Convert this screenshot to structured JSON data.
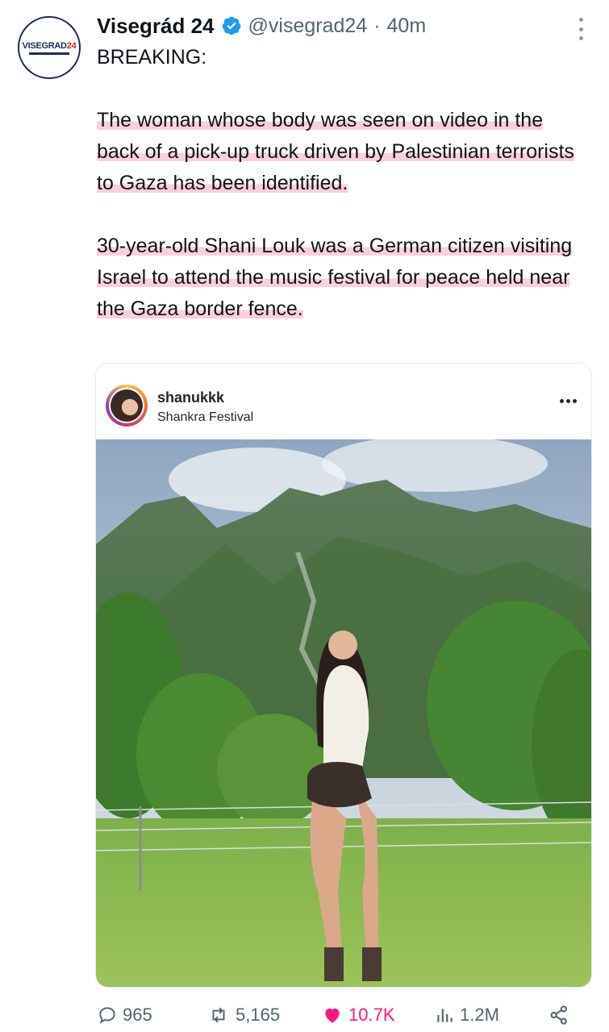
{
  "account": {
    "avatar_text": "VISEGRAD24",
    "name": "Visegrád 24",
    "handle": "@visegrad24",
    "separator": "·",
    "time": "40m",
    "verified_icon": "verified-badge-icon"
  },
  "tweet": {
    "line1": "BREAKING:",
    "paragraph1": "The woman whose body was seen on video in the back of a pick-up truck driven by Palestinian terrorists to Gaza has been identified.",
    "paragraph2": "30-year-old Shani Louk was a German citizen visiting Israel to attend the music festival for peace held near the Gaza border fence."
  },
  "embedded_post": {
    "username": "shanukkk",
    "location": "Shankra Festival"
  },
  "actions": {
    "replies": "965",
    "reposts": "5,165",
    "likes": "10.7K",
    "views": "1.2M"
  },
  "colors": {
    "text": "#0f1419",
    "secondary": "#536471",
    "verified": "#1d9bf0",
    "like": "#f91880",
    "highlight": "#eb7896"
  }
}
